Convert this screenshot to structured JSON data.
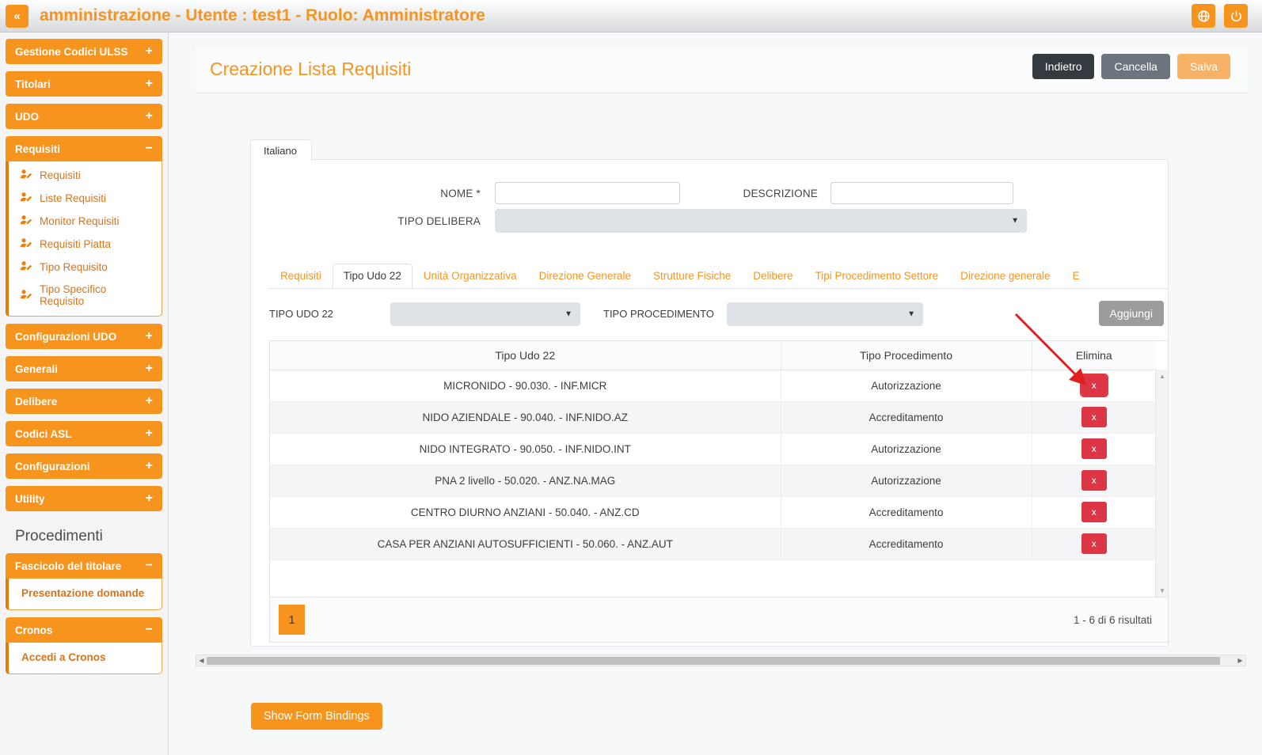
{
  "topbar": {
    "menu_toggle": "«",
    "title": "amministrazione - Utente : test1 - Ruolo: Amministratore",
    "language_icon": "globe-icon",
    "logout_icon": "power-icon"
  },
  "sidebar": {
    "groups": [
      {
        "label": "Gestione Codici ULSS",
        "toggle": "+",
        "open": false,
        "items": []
      },
      {
        "label": "Titolari",
        "toggle": "+",
        "open": false,
        "items": []
      },
      {
        "label": "UDO",
        "toggle": "+",
        "open": false,
        "items": []
      },
      {
        "label": "Requisiti",
        "toggle": "−",
        "open": true,
        "items": [
          "Requisiti",
          "Liste Requisiti",
          "Monitor Requisiti",
          "Requisiti Piatta",
          "Tipo Requisito",
          "Tipo Specifico Requisito"
        ]
      },
      {
        "label": "Configurazioni UDO",
        "toggle": "+",
        "open": false,
        "items": []
      },
      {
        "label": "Generali",
        "toggle": "+",
        "open": false,
        "items": []
      },
      {
        "label": "Delibere",
        "toggle": "+",
        "open": false,
        "items": []
      },
      {
        "label": "Codici ASL",
        "toggle": "+",
        "open": false,
        "items": []
      },
      {
        "label": "Configurazioni",
        "toggle": "+",
        "open": false,
        "items": []
      },
      {
        "label": "Utility",
        "toggle": "+",
        "open": false,
        "items": []
      }
    ],
    "section_title": "Procedimenti",
    "groups2": [
      {
        "label": "Fascicolo del titolare",
        "toggle": "−",
        "open": true,
        "items": [
          "Presentazione domande"
        ]
      },
      {
        "label": "Cronos",
        "toggle": "−",
        "open": true,
        "items": [
          "Accedi a Cronos"
        ]
      }
    ]
  },
  "page": {
    "title": "Creazione Lista Requisiti",
    "buttons": {
      "back": "Indietro",
      "cancel": "Cancella",
      "save": "Salva"
    }
  },
  "form": {
    "language_tab": "Italiano",
    "nome_label": "NOME *",
    "nome_value": "",
    "descrizione_label": "DESCRIZIONE",
    "descrizione_value": "",
    "tipo_delibera_label": "TIPO DELIBERA",
    "tipo_delibera_value": "",
    "caret": "▼"
  },
  "tabs": [
    {
      "label": "Requisiti",
      "active": false
    },
    {
      "label": "Tipo Udo 22",
      "active": true
    },
    {
      "label": "Unità Organizzativa",
      "active": false
    },
    {
      "label": "Direzione Generale",
      "active": false
    },
    {
      "label": "Strutture Fisiche",
      "active": false
    },
    {
      "label": "Delibere",
      "active": false
    },
    {
      "label": "Tipi Procedimento Settore",
      "active": false
    },
    {
      "label": "Direzione generale",
      "active": false
    },
    {
      "label": "E",
      "active": false
    }
  ],
  "inner_controls": {
    "tipo_udo_label": "TIPO UDO 22",
    "tipo_udo_value": "",
    "tipo_procedimento_label": "TIPO PROCEDIMENTO",
    "tipo_procedimento_value": "",
    "add_button": "Aggiungi",
    "caret": "▼"
  },
  "table": {
    "columns": [
      "Tipo Udo 22",
      "Tipo Procedimento",
      "Elimina"
    ],
    "delete_glyph": "x",
    "rows": [
      {
        "tipo_udo": "MICRONIDO - 90.030. - INF.MICR",
        "tipo_procedimento": "Autorizzazione"
      },
      {
        "tipo_udo": "NIDO AZIENDALE - 90.040. - INF.NIDO.AZ",
        "tipo_procedimento": "Accreditamento"
      },
      {
        "tipo_udo": "NIDO INTEGRATO - 90.050. - INF.NIDO.INT",
        "tipo_procedimento": "Autorizzazione"
      },
      {
        "tipo_udo": "PNA 2 livello - 50.020. - ANZ.NA.MAG",
        "tipo_procedimento": "Autorizzazione"
      },
      {
        "tipo_udo": "CENTRO DIURNO ANZIANI - 50.040. - ANZ.CD",
        "tipo_procedimento": "Accreditamento"
      },
      {
        "tipo_udo": "CASA PER ANZIANI AUTOSUFFICIENTI - 50.060. - ANZ.AUT",
        "tipo_procedimento": "Accreditamento"
      }
    ]
  },
  "pager": {
    "current_page": "1",
    "info": "1 - 6 di 6 risultati"
  },
  "footer": {
    "show_form_bindings": "Show Form Bindings"
  },
  "colors": {
    "brand_orange": "#f7941e",
    "danger_red": "#dc3545",
    "dark_button": "#343a40",
    "grey_button": "#6c757d",
    "annotation_red": "#e02020"
  }
}
